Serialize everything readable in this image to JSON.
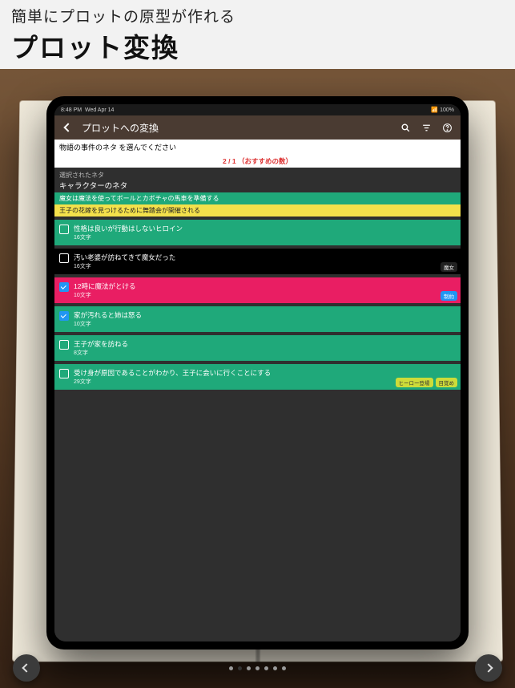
{
  "promo": {
    "subtitle": "簡単にプロットの原型が作れる",
    "title": "プロット変換"
  },
  "status": {
    "time": "8:48 PM",
    "date": "Wed Apr 14",
    "battery": "100%"
  },
  "appbar": {
    "back_icon": "chevron-left-icon",
    "title": "プロットへの変換",
    "search_icon": "search-icon",
    "filter_icon": "filter-icon",
    "help_icon": "help-icon"
  },
  "prompt_line": "物語の事件のネタ を選んでください",
  "recommend_line": "2 / 1 （おすすめの数）",
  "selected_label": "選択されたネタ",
  "category_label": "キャラクターのネタ",
  "selected_strips": [
    {
      "color": "green",
      "text": "魔女は魔法を使ってボールとカボチャの馬車を準備する"
    },
    {
      "color": "yellow",
      "text": "王子の花嫁を見つけるために舞踏会が開催される"
    }
  ],
  "items": [
    {
      "style": "green",
      "checked": false,
      "title": "性格は良いが行動はしないヒロイン",
      "chars": "16文字",
      "tags": []
    },
    {
      "style": "black",
      "checked": false,
      "title": "汚い老婆が訪ねてきて魔女だった",
      "chars": "16文字",
      "tags": [
        {
          "label": "魔女",
          "kind": "dark",
          "pos": "bottom"
        }
      ]
    },
    {
      "style": "pink",
      "checked": true,
      "title": "12時に魔法がとける",
      "chars": "10文字",
      "tags": [
        {
          "label": "制約",
          "kind": "blue",
          "pos": "bottom"
        }
      ]
    },
    {
      "style": "green",
      "checked": true,
      "title": "家が汚れると姉は怒る",
      "chars": "10文字",
      "tags": []
    },
    {
      "style": "green",
      "checked": false,
      "title": "王子が家を訪ねる",
      "chars": "8文字",
      "tags": []
    },
    {
      "style": "green",
      "checked": false,
      "title": "受け身が原因であることがわかり、王子に会いに行くことにする",
      "chars": "29文字",
      "tags": [
        {
          "label": "ヒーロー登場",
          "kind": "lime",
          "pos": "row"
        },
        {
          "label": "目覚め",
          "kind": "lime",
          "pos": "row"
        }
      ]
    }
  ],
  "pager": {
    "total": 7,
    "active_index": 1
  }
}
